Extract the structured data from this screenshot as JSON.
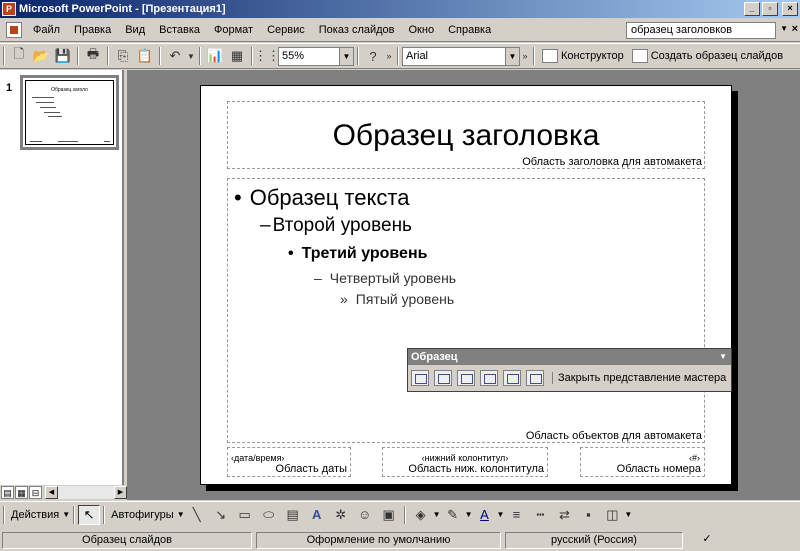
{
  "window": {
    "title": "Microsoft PowerPoint - [Презентация1]",
    "app_icon_letter": "P"
  },
  "menu": {
    "items": [
      "Файл",
      "Правка",
      "Вид",
      "Вставка",
      "Формат",
      "Сервис",
      "Показ слайдов",
      "Окно",
      "Справка"
    ],
    "help_box_value": "образец заголовков"
  },
  "toolbar": {
    "zoom": "55%",
    "font": "Arial",
    "designer_label": "Конструктор",
    "create_master_label": "Создать образец слайдов"
  },
  "slides_pane": {
    "slide_number": "1",
    "thumb_title": "Образец заголо"
  },
  "slide": {
    "title": "Образец заголовка",
    "title_caption": "Область заголовка для автомакета",
    "levels": [
      {
        "bullet": "•",
        "text": "Образец текста"
      },
      {
        "bullet": "–",
        "text": "Второй уровень"
      },
      {
        "bullet": "•",
        "text": "Третий уровень"
      },
      {
        "bullet": "–",
        "text": "Четвертый уровень"
      },
      {
        "bullet": "»",
        "text": "Пятый уровень"
      }
    ],
    "body_caption": "Область объектов для автомакета",
    "date_tag": "‹дата/время›",
    "date_caption": "Область даты",
    "footer_tag": "‹нижний колонтитул›",
    "footer_caption": "Область ниж. колонтитула",
    "number_tag": "‹#›",
    "number_caption": "Область номера"
  },
  "master_toolbar": {
    "title": "Образец",
    "close_label": "Закрыть представление мастера"
  },
  "drawing_toolbar": {
    "actions_label": "Действия",
    "autoshapes_label": "Автофигуры"
  },
  "statusbar": {
    "view": "Образец слайдов",
    "design": "Оформление по умолчанию",
    "language": "русский (Россия)"
  }
}
